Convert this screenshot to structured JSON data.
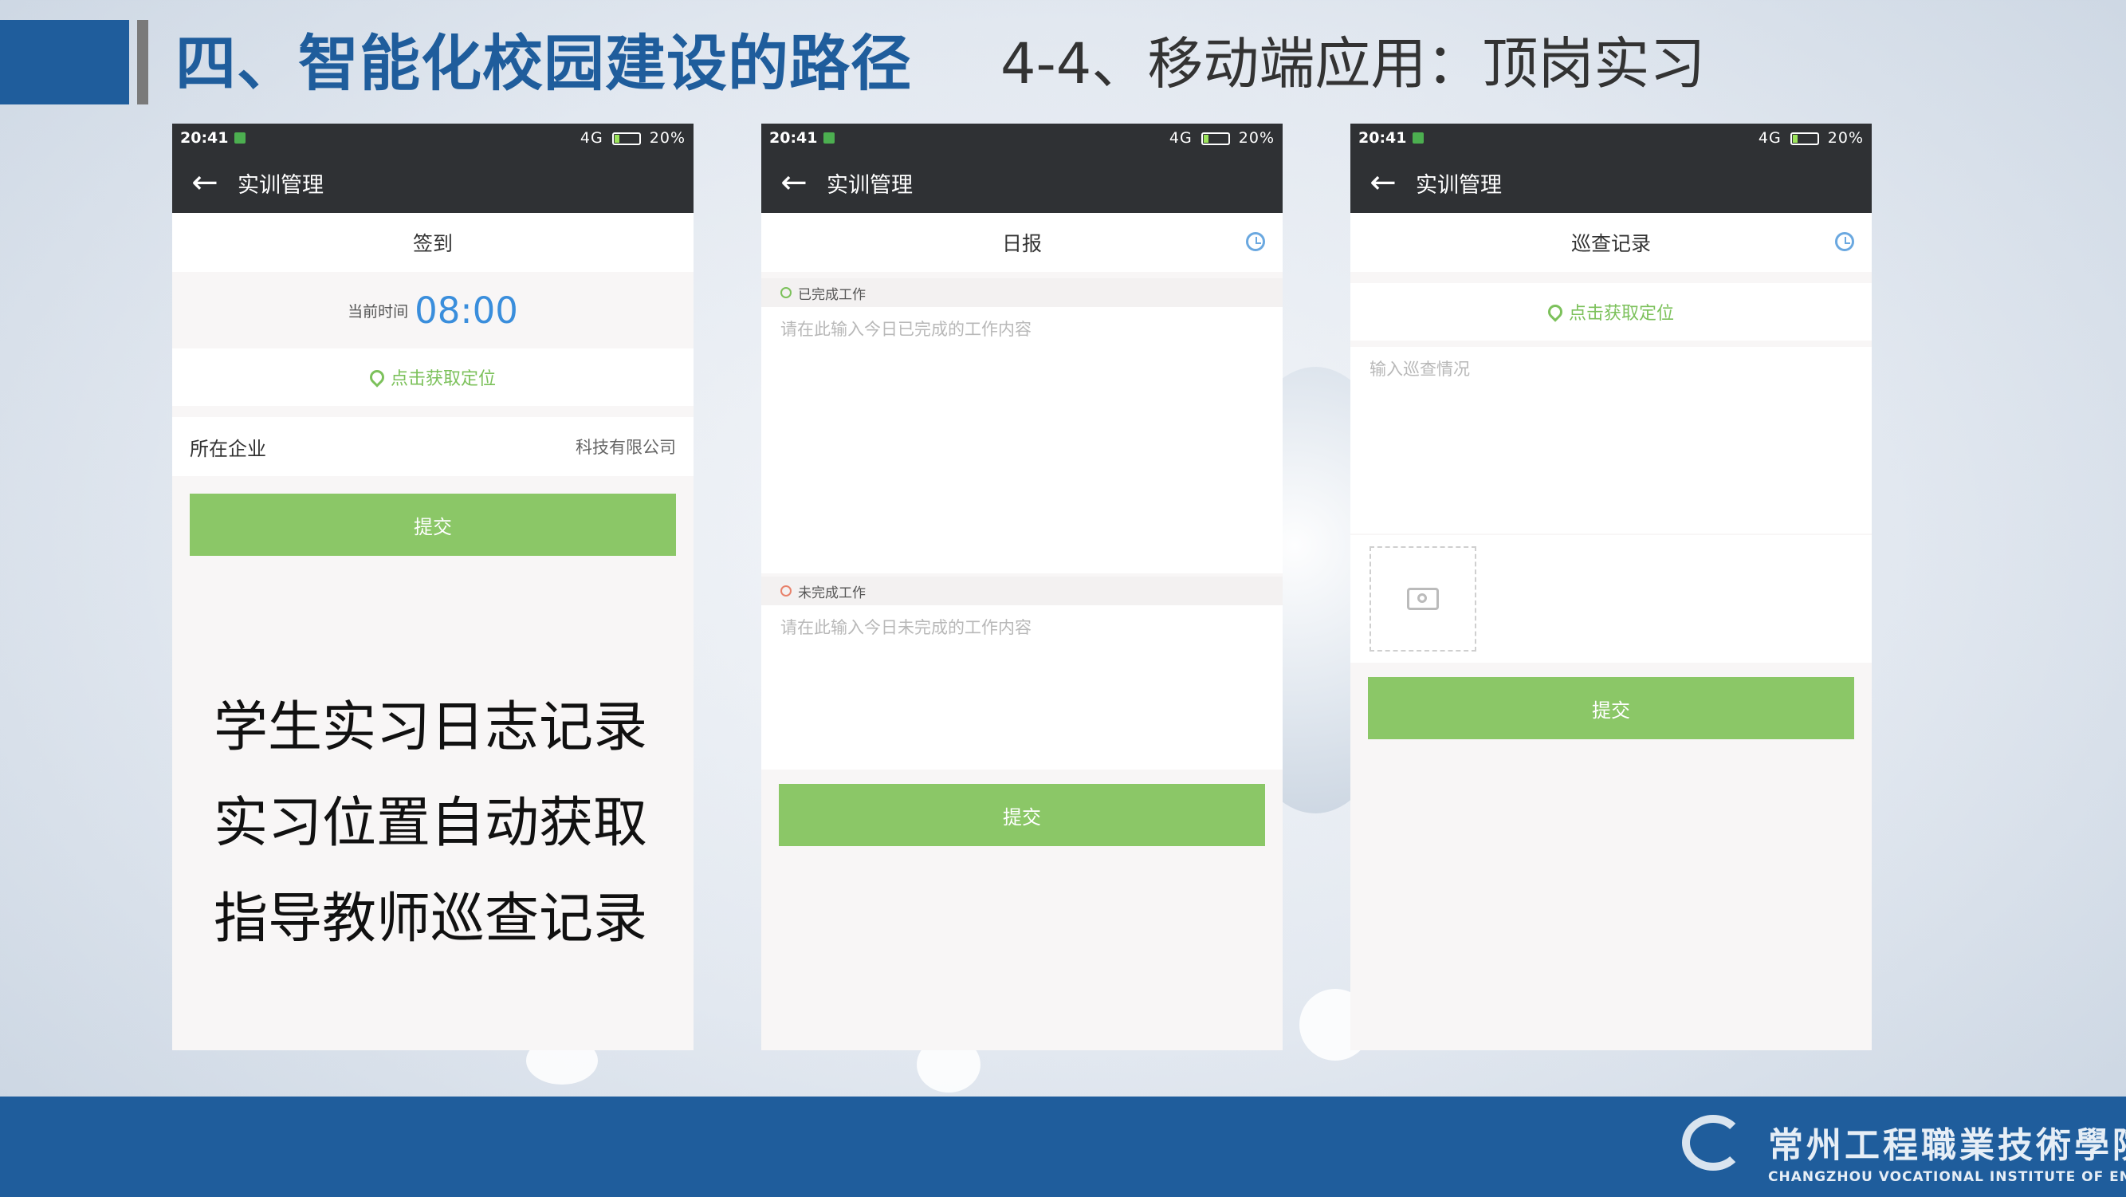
{
  "header": {
    "title": "四、智能化校园建设的路径",
    "subtitle": "4-4、移动端应用：顶岗实习"
  },
  "status_bar": {
    "time": "20:41",
    "network": "4G",
    "battery": "20%"
  },
  "phone1": {
    "app_title": "实训管理",
    "screen_title": "签到",
    "time_label": "当前时间",
    "time_value": "08:00",
    "location_label": "点击获取定位",
    "company_label": "所在企业",
    "company_value": "科技有限公司",
    "submit_label": "提交"
  },
  "phone2": {
    "app_title": "实训管理",
    "screen_title": "日报",
    "done_label": "已完成工作",
    "done_placeholder": "请在此输入今日已完成的工作内容",
    "todo_label": "未完成工作",
    "todo_placeholder": "请在此输入今日未完成的工作内容",
    "submit_label": "提交"
  },
  "phone3": {
    "app_title": "实训管理",
    "screen_title": "巡查记录",
    "location_label": "点击获取定位",
    "input_placeholder": "输入巡查情况",
    "submit_label": "提交"
  },
  "captions": [
    "学生实习日志记录",
    "实习位置自动获取",
    "指导教师巡查记录"
  ],
  "footer": {
    "school_cn": "常州工程職業技術學院",
    "school_en": "CHANGZHOU VOCATIONAL INSTITUTE OF ENGINEERING"
  },
  "colors": {
    "brand_blue": "#1f5d9c",
    "submit_green": "#8bc767",
    "location_green": "#7cc15b",
    "time_blue": "#3a8edc",
    "appbar_dark": "#2f3134"
  },
  "icons": [
    "back-arrow-icon",
    "clock-icon",
    "location-pin-icon",
    "check-circle-icon",
    "warning-circle-icon",
    "camera-icon"
  ]
}
